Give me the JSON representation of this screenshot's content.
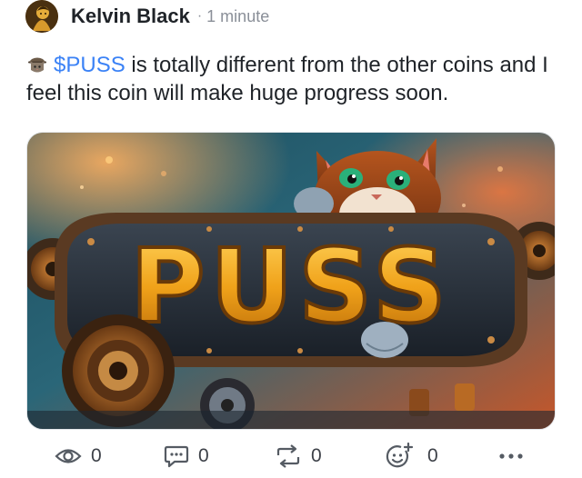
{
  "post": {
    "author": "Kelvin Black",
    "separator": "·",
    "time": "1 minute",
    "text_ticker": "$PUSS",
    "text_body": " is totally different from the other coins and I feel this coin will make huge progress soon.",
    "image_title": "PUSS"
  },
  "actions": {
    "views": {
      "icon": "eye-icon",
      "count": "0"
    },
    "comments": {
      "icon": "comment-icon",
      "count": "0"
    },
    "reposts": {
      "icon": "repost-icon",
      "count": "0"
    },
    "reactions": {
      "icon": "add-reaction-icon",
      "count": "0"
    },
    "more": {
      "icon": "more-icon",
      "label": "•••"
    }
  },
  "colors": {
    "ticker": "#3b82f6",
    "text": "#1f2328",
    "muted": "#8a8f98",
    "icon": "#555b63"
  }
}
